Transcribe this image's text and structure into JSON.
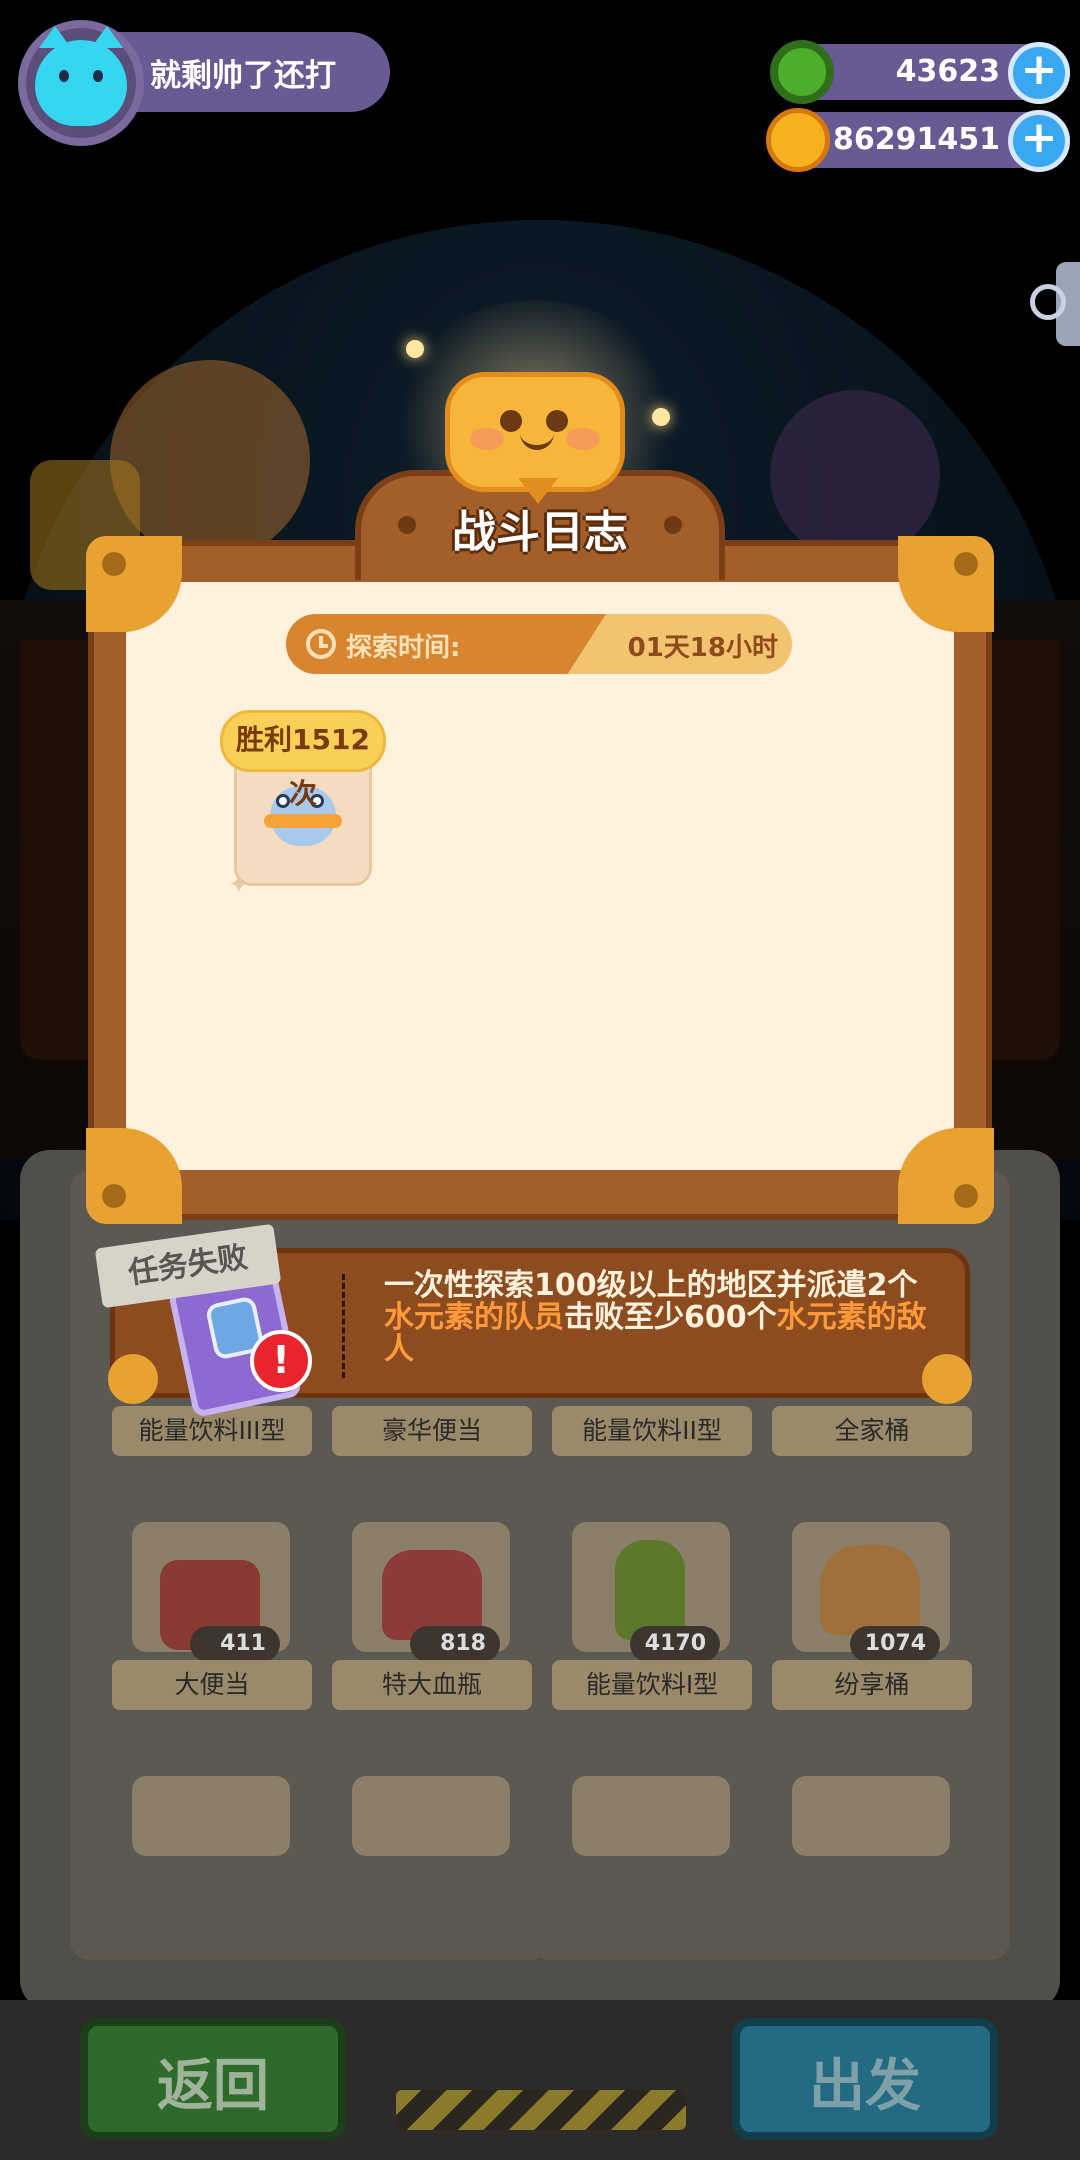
{
  "player": {
    "name": "就剩帅了还打"
  },
  "currencies": [
    {
      "icon": "green-ring-icon",
      "value": "43623"
    },
    {
      "icon": "gold-planet-icon",
      "value": "86291451"
    }
  ],
  "dialog": {
    "title": "战斗日志",
    "time": {
      "label": "探索时间:",
      "value": "01天18小时"
    },
    "victory": {
      "label": "胜利1512次"
    }
  },
  "mission": {
    "status": "任务失败",
    "text_1": "一次性探索100级以上的地区并派遣2个",
    "hl_1": "水元素的队员",
    "text_2": "击败至少600个",
    "hl_2": "水元素的敌人"
  },
  "items": {
    "row1": [
      "能量饮料III型",
      "豪华便当",
      "能量饮料II型",
      "全家桶"
    ],
    "row2": [
      {
        "label": "大便当",
        "count": "411"
      },
      {
        "label": "特大血瓶",
        "count": "818"
      },
      {
        "label": "能量饮料I型",
        "count": "4170"
      },
      {
        "label": "纷享桶",
        "count": "1074"
      }
    ]
  },
  "buttons": {
    "back": "返回",
    "go": "出发"
  },
  "colors": {
    "accent_orange": "#ff9a3a",
    "panel_brown": "#a45e29",
    "panel_cream": "#fff2dc"
  }
}
